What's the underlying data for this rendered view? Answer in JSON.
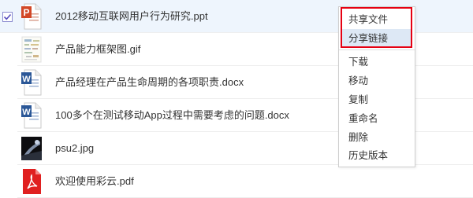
{
  "files": [
    {
      "name": "2012移动互联网用户行为研究.ppt",
      "type": "ppt",
      "icon_label": "P",
      "selected": true
    },
    {
      "name": "产品能力框架图.gif",
      "type": "gif",
      "selected": false
    },
    {
      "name": "产品经理在产品生命周期的各项职责.docx",
      "type": "docx",
      "icon_label": "W",
      "selected": false
    },
    {
      "name": "100多个在测试移动App过程中需要考虑的问题.docx",
      "type": "docx",
      "icon_label": "W",
      "selected": false
    },
    {
      "name": "psu2.jpg",
      "type": "jpg",
      "selected": false
    },
    {
      "name": "欢迎使用彩云.pdf",
      "type": "pdf",
      "selected": false
    }
  ],
  "context_menu": {
    "highlighted_items": [
      "共享文件",
      "分享链接"
    ],
    "items": [
      "下载",
      "移动",
      "复制",
      "重命名",
      "删除",
      "历史版本"
    ]
  },
  "colors": {
    "ppt": "#d24726",
    "docx": "#2b5797",
    "pdf": "#e02020",
    "selected_row": "#eef5fd",
    "highlight_border": "#e60012"
  }
}
